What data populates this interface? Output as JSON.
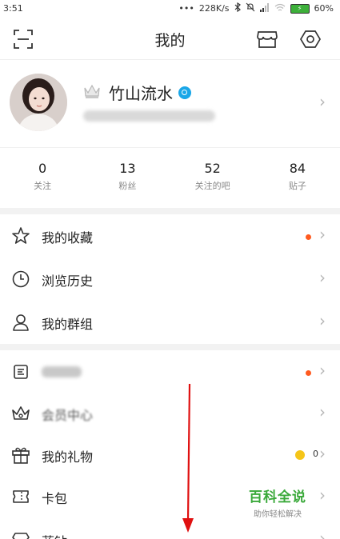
{
  "status_bar": {
    "time": "3:51",
    "dots": "•••",
    "speed": "228K/s",
    "battery": "60%",
    "battery_color": "#3db03a"
  },
  "header": {
    "title": "我的",
    "left_icon": "scan-icon",
    "right_icons": [
      "shop-icon",
      "settings-icon"
    ]
  },
  "profile": {
    "username": "竹山流水",
    "badge_color": "#1aa7e8"
  },
  "stats": [
    {
      "value": "0",
      "label": "关注"
    },
    {
      "value": "13",
      "label": "粉丝"
    },
    {
      "value": "52",
      "label": "关注的吧"
    },
    {
      "value": "84",
      "label": "贴子"
    }
  ],
  "menu_group_1": [
    {
      "label": "我的收藏",
      "icon": "star-icon",
      "has_dot": true
    },
    {
      "label": "浏览历史",
      "icon": "clock-icon",
      "has_dot": false
    },
    {
      "label": "我的群组",
      "icon": "person-icon",
      "has_dot": false
    }
  ],
  "menu_group_2": [
    {
      "label": "",
      "icon": "badge-icon",
      "has_dot": true,
      "blurred": true
    },
    {
      "label": "会员中心",
      "icon": "crown-icon",
      "has_dot": false,
      "blurred": true
    },
    {
      "label": "我的礼物",
      "icon": "gift-icon",
      "has_dot": false,
      "coin_count": "0"
    },
    {
      "label": "卡包",
      "icon": "ticket-icon",
      "has_dot": false
    },
    {
      "label": "蓝钻",
      "icon": "diamond-icon",
      "has_dot": false
    }
  ],
  "watermark": {
    "title": "百科全说",
    "subtitle": "助你轻松解决"
  },
  "colors": {
    "accent_dot": "#ff5a1f",
    "annotation_arrow": "#e01010",
    "watermark_green": "#3aa93a"
  }
}
